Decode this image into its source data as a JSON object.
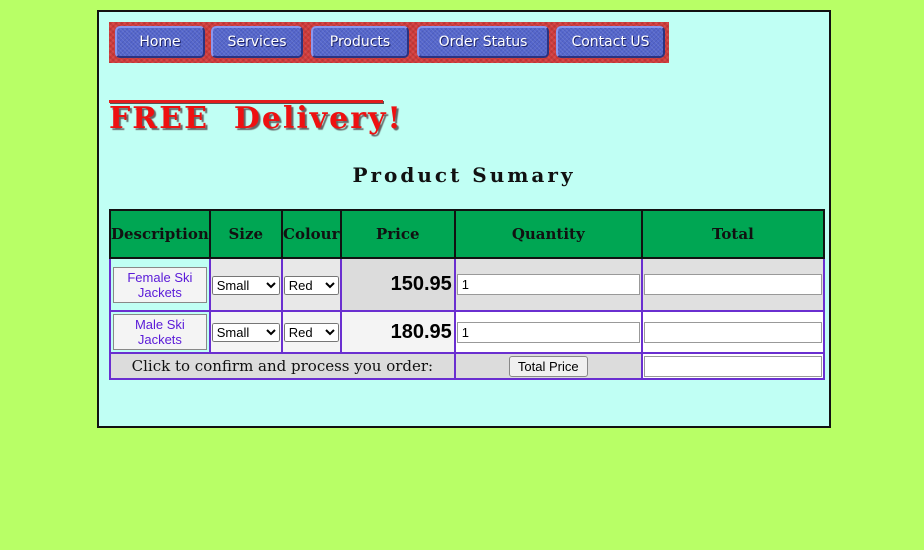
{
  "nav": {
    "items": [
      {
        "label": "Home"
      },
      {
        "label": "Services"
      },
      {
        "label": "Products"
      },
      {
        "label": "Order Status"
      },
      {
        "label": "Contact US"
      }
    ]
  },
  "banner": {
    "headline": "FREE  Delivery!"
  },
  "summary": {
    "title": "Product Sumary"
  },
  "table": {
    "headers": {
      "description": "Description",
      "size": "Size",
      "colour": "Colour",
      "price": "Price",
      "quantity": "Quantity",
      "total": "Total"
    },
    "rows": [
      {
        "description": "Female Ski Jackets",
        "size": "Small",
        "colour": "Red",
        "price": "150.95",
        "quantity": "1",
        "total": ""
      },
      {
        "description": "Male Ski Jackets",
        "size": "Small",
        "colour": "Red",
        "price": "180.95",
        "quantity": "1",
        "total": ""
      }
    ],
    "confirm_text": "Click to confirm and process you order:",
    "total_button": "Total Price",
    "grand_total": ""
  },
  "colors": {
    "page_background": "#b8ff66",
    "panel_background": "#c0fff4",
    "header_green": "#00a653",
    "nav_red": "#d23a3a",
    "nav_button_blue": "#5566cc",
    "delivery_red": "#ee1111",
    "cell_border_purple": "#6a2fd0"
  }
}
